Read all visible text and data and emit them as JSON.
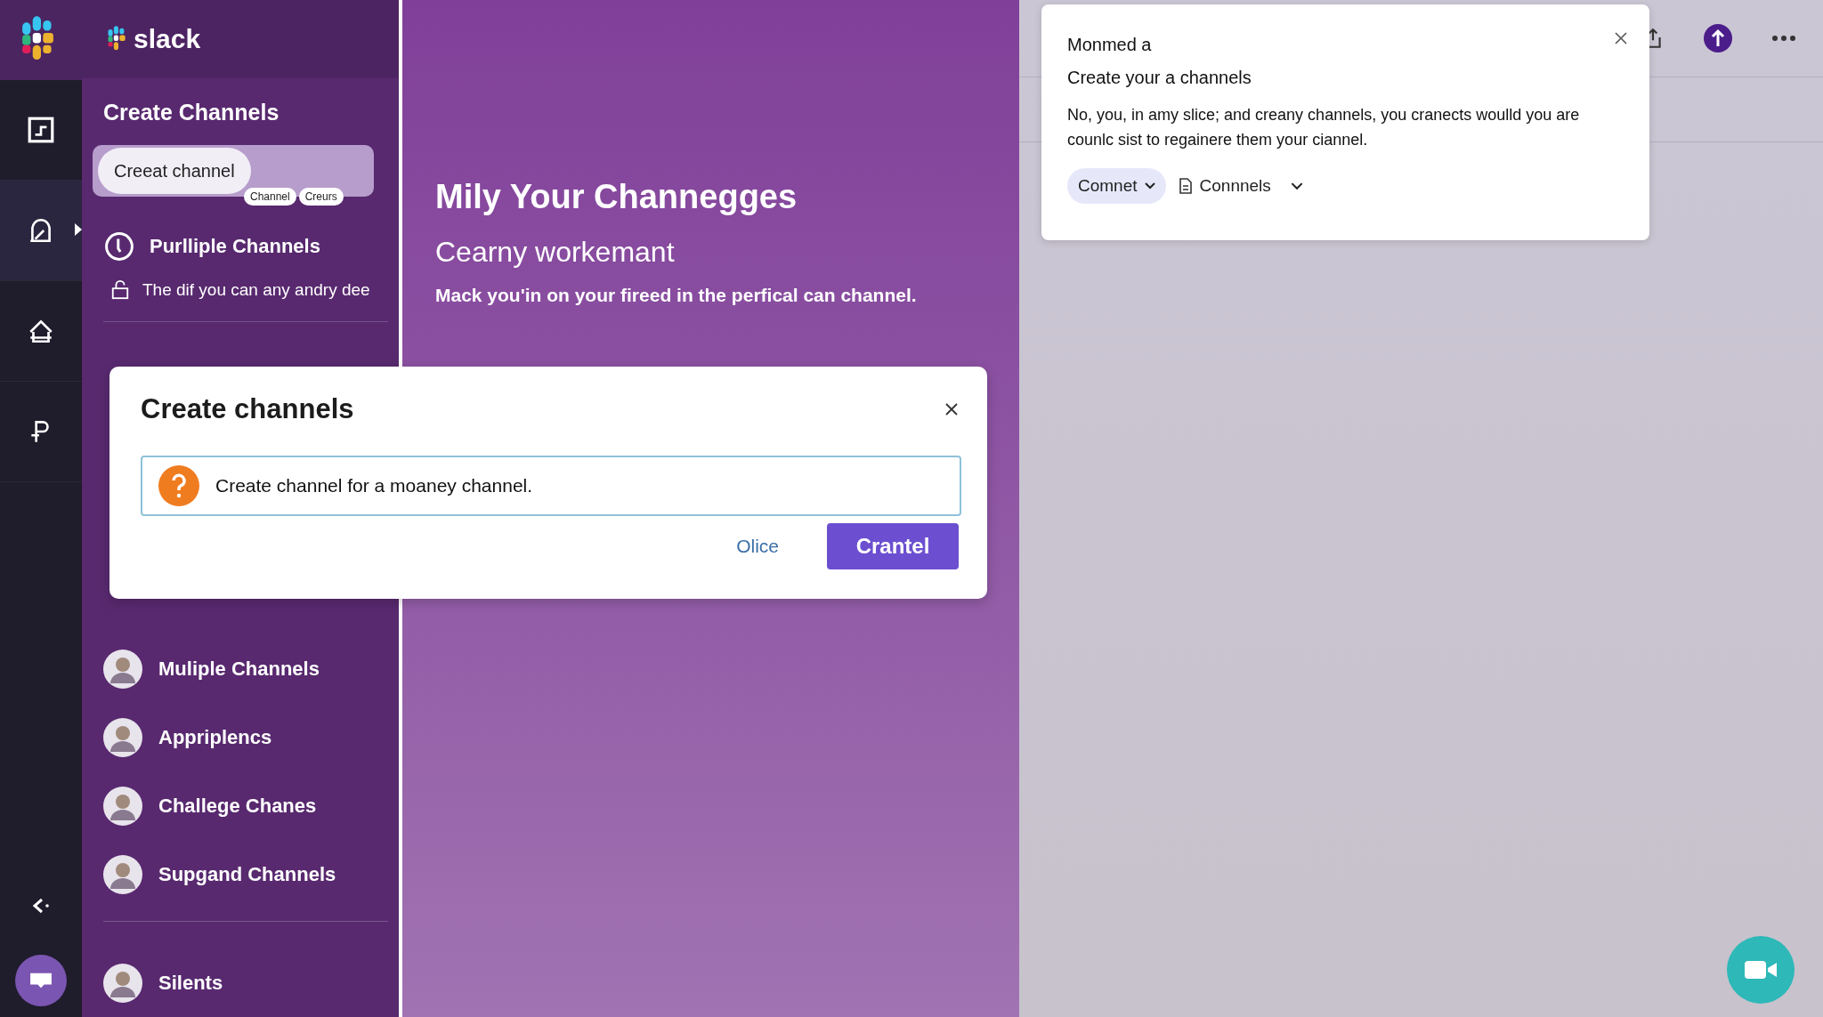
{
  "rail": {
    "items": [
      {
        "selected": false
      },
      {
        "selected": true
      },
      {
        "selected": false
      },
      {
        "selected": false
      }
    ]
  },
  "sidebar": {
    "brand": "slack",
    "title": "Create Channels",
    "create_button": "Creeat channel",
    "tags": [
      "Channel",
      "Creurs"
    ],
    "section": "Purlliple Channels",
    "note": "The dif you can any andry dee",
    "channels": [
      {
        "name": "Muliple Channels"
      },
      {
        "name": "Appriplencs"
      },
      {
        "name": "Challege Chanes"
      },
      {
        "name": "Supgand Channels"
      }
    ],
    "footer_channels": [
      {
        "name": "Silents"
      }
    ]
  },
  "panel": {
    "title": "Mily Your Channegges",
    "subtitle": "Cearny workemant",
    "body": "Mack you'in on your fireed in the perfical can channel."
  },
  "popup": {
    "heading": "Monmed a",
    "title": "Create your a channels",
    "body": "No, you, in amy slice; and creany channels, you cranects woulld you are counlc sist to regainere them your ciannel.",
    "chip": "Comnet",
    "menu": "Connnels"
  },
  "dialog": {
    "title": "Create channels",
    "message": "Create channel for a moaney channel.",
    "secondary": "Olice",
    "primary": "Crantel"
  }
}
